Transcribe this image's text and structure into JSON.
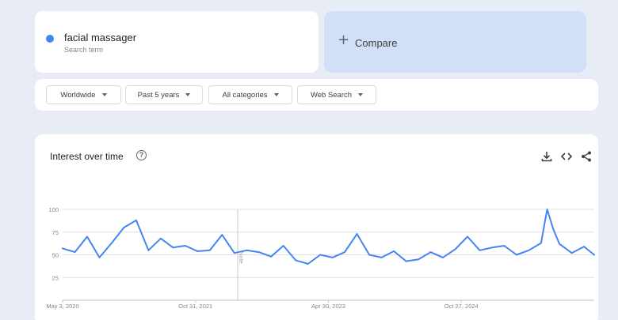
{
  "search_term": {
    "name": "facial massager",
    "sublabel": "Search term",
    "color": "#4285f4"
  },
  "compare": {
    "label": "Compare",
    "icon": "plus-icon"
  },
  "filters": {
    "region": "Worldwide",
    "time_range": "Past 5 years",
    "category": "All categories",
    "search_type": "Web Search"
  },
  "chart": {
    "title": "Interest over time",
    "help_icon": "?",
    "toolbar_icons": [
      "download-icon",
      "embed-code-icon",
      "share-icon"
    ],
    "note_marker": "Note"
  },
  "chart_data": {
    "type": "line",
    "title": "Interest over time",
    "xlabel": "",
    "ylabel": "",
    "ylim": [
      0,
      100
    ],
    "yticks": [
      25,
      50,
      75,
      100
    ],
    "grid": true,
    "xtick_labels": [
      "May 3, 2020",
      "Oct 31, 2021",
      "Apr 30, 2023",
      "Oct 27, 2024"
    ],
    "series": [
      {
        "name": "facial massager",
        "color": "#4285f4",
        "x": [
          "2020-05-03",
          "2020-06-14",
          "2020-07-26",
          "2020-09-06",
          "2020-10-18",
          "2020-11-29",
          "2021-01-10",
          "2021-02-21",
          "2021-04-04",
          "2021-05-16",
          "2021-06-27",
          "2021-08-08",
          "2021-09-19",
          "2021-10-31",
          "2021-12-12",
          "2022-01-23",
          "2022-03-06",
          "2022-04-17",
          "2022-05-29",
          "2022-07-10",
          "2022-08-21",
          "2022-10-02",
          "2022-11-13",
          "2022-12-25",
          "2023-02-05",
          "2023-03-19",
          "2023-04-30",
          "2023-06-11",
          "2023-07-23",
          "2023-09-03",
          "2023-10-15",
          "2023-11-26",
          "2024-01-07",
          "2024-02-18",
          "2024-03-31",
          "2024-05-12",
          "2024-06-23",
          "2024-08-04",
          "2024-09-15",
          "2024-10-27",
          "2024-11-17",
          "2024-12-08",
          "2024-12-29",
          "2025-02-09",
          "2025-03-23",
          "2025-04-27"
        ],
        "values": [
          57,
          53,
          70,
          47,
          63,
          80,
          88,
          55,
          68,
          58,
          60,
          54,
          55,
          72,
          52,
          55,
          53,
          48,
          60,
          44,
          40,
          50,
          47,
          53,
          73,
          50,
          47,
          54,
          43,
          45,
          53,
          47,
          56,
          70,
          55,
          58,
          60,
          50,
          55,
          63,
          100,
          78,
          62,
          52,
          59,
          50
        ]
      }
    ]
  }
}
